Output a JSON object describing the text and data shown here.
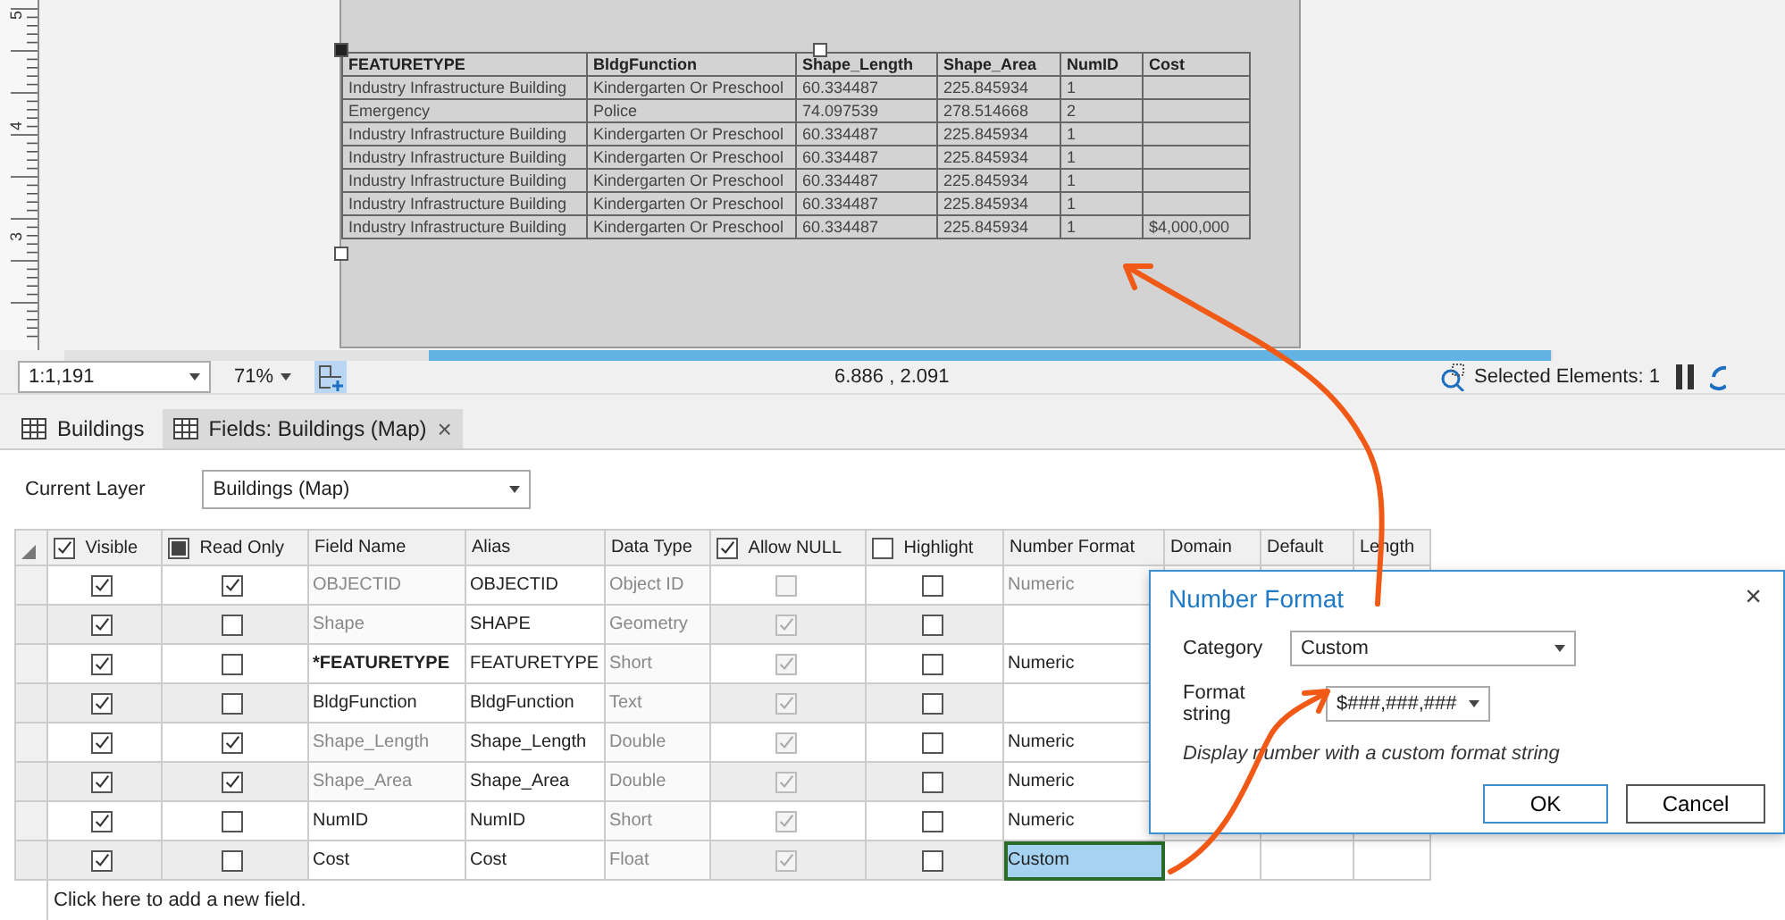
{
  "ruler": {
    "labels": [
      "5",
      "4",
      "3"
    ]
  },
  "map_table": {
    "columns": [
      "FEATURETYPE",
      "BldgFunction",
      "Shape_Length",
      "Shape_Area",
      "NumID",
      "Cost"
    ],
    "rows": [
      [
        "Industry Infrastructure Building",
        "Kindergarten Or Preschool",
        "60.334487",
        "225.845934",
        "1",
        ""
      ],
      [
        "Emergency",
        "Police",
        "74.097539",
        "278.514668",
        "2",
        ""
      ],
      [
        "Industry Infrastructure Building",
        "Kindergarten Or Preschool",
        "60.334487",
        "225.845934",
        "1",
        ""
      ],
      [
        "Industry Infrastructure Building",
        "Kindergarten Or Preschool",
        "60.334487",
        "225.845934",
        "1",
        ""
      ],
      [
        "Industry Infrastructure Building",
        "Kindergarten Or Preschool",
        "60.334487",
        "225.845934",
        "1",
        ""
      ],
      [
        "Industry Infrastructure Building",
        "Kindergarten Or Preschool",
        "60.334487",
        "225.845934",
        "1",
        ""
      ],
      [
        "Industry Infrastructure Building",
        "Kindergarten Or Preschool",
        "60.334487",
        "225.845934",
        "1",
        "$4,000,000"
      ]
    ]
  },
  "status_bar": {
    "scale": "1:1,191",
    "zoom": "71%",
    "coordinates": "6.886 , 2.091",
    "selected_elements": "Selected Elements: 1"
  },
  "tabs": [
    {
      "label": "Buildings",
      "selected": false
    },
    {
      "label": "Fields:  Buildings (Map)",
      "selected": true,
      "close": "×"
    }
  ],
  "current_layer": {
    "label": "Current Layer",
    "value": "Buildings (Map)"
  },
  "fields_grid": {
    "columns": [
      {
        "label": "Visible",
        "kind": "checkbox",
        "checked": true,
        "indeterminate": false
      },
      {
        "label": "Read Only",
        "kind": "checkbox",
        "checked": false,
        "indeterminate": true
      },
      {
        "label": "Field Name",
        "kind": "text"
      },
      {
        "label": "Alias",
        "kind": "text"
      },
      {
        "label": "Data Type",
        "kind": "text"
      },
      {
        "label": "Allow NULL",
        "kind": "checkbox",
        "checked": true,
        "indeterminate": false
      },
      {
        "label": "Highlight",
        "kind": "checkbox",
        "checked": false,
        "indeterminate": false
      },
      {
        "label": "Number Format",
        "kind": "text"
      },
      {
        "label": "Domain",
        "kind": "text"
      },
      {
        "label": "Default",
        "kind": "text"
      },
      {
        "label": "Length",
        "kind": "text"
      }
    ],
    "rows": [
      {
        "visible": true,
        "read_only": true,
        "field_name": "OBJECTID",
        "name_editable": false,
        "bold": false,
        "alias": "OBJECTID",
        "data_type": "Object ID",
        "allow_null": false,
        "highlight": false,
        "number_format": {
          "value": "Numeric",
          "disabled": true,
          "selected": false
        }
      },
      {
        "visible": true,
        "read_only": false,
        "field_name": "Shape",
        "name_editable": false,
        "bold": false,
        "alias": "SHAPE",
        "data_type": "Geometry",
        "allow_null": true,
        "highlight": false,
        "number_format": {
          "disabled": false,
          "selected": false
        }
      },
      {
        "visible": true,
        "read_only": false,
        "field_name": "*FEATURETYPE",
        "name_editable": true,
        "bold": true,
        "alias": "FEATURETYPE",
        "data_type": "Short",
        "allow_null": true,
        "highlight": false,
        "number_format": {
          "value": "Numeric",
          "disabled": false,
          "selected": false
        }
      },
      {
        "visible": true,
        "read_only": false,
        "field_name": "BldgFunction",
        "name_editable": true,
        "bold": false,
        "alias": "BldgFunction",
        "data_type": "Text",
        "allow_null": true,
        "highlight": false,
        "number_format": {
          "disabled": false,
          "selected": false
        }
      },
      {
        "visible": true,
        "read_only": true,
        "field_name": "Shape_Length",
        "name_editable": false,
        "bold": false,
        "alias": "Shape_Length",
        "data_type": "Double",
        "allow_null": true,
        "highlight": false,
        "number_format": {
          "value": "Numeric",
          "disabled": false,
          "selected": false
        }
      },
      {
        "visible": true,
        "read_only": true,
        "field_name": "Shape_Area",
        "name_editable": false,
        "bold": false,
        "alias": "Shape_Area",
        "data_type": "Double",
        "allow_null": true,
        "highlight": false,
        "number_format": {
          "value": "Numeric",
          "disabled": false,
          "selected": false
        }
      },
      {
        "visible": true,
        "read_only": false,
        "field_name": "NumID",
        "name_editable": true,
        "bold": false,
        "alias": "NumID",
        "data_type": "Short",
        "allow_null": true,
        "highlight": false,
        "number_format": {
          "value": "Numeric",
          "disabled": false,
          "selected": false
        }
      },
      {
        "visible": true,
        "read_only": false,
        "field_name": "Cost",
        "name_editable": true,
        "bold": false,
        "alias": "Cost",
        "data_type": "Float",
        "allow_null": true,
        "highlight": false,
        "number_format": {
          "value": "Custom",
          "disabled": false,
          "selected": true
        }
      }
    ],
    "footer": "Click here to add a new field."
  },
  "dialog": {
    "title": "Number Format",
    "close": "×",
    "category_label": "Category",
    "category": "Custom",
    "format_label": "Format string",
    "format": "$###,###,###",
    "hint": "Display number with a custom format string",
    "buttons": [
      {
        "label": "OK",
        "default": true
      },
      {
        "label": "Cancel",
        "default": false
      }
    ]
  }
}
